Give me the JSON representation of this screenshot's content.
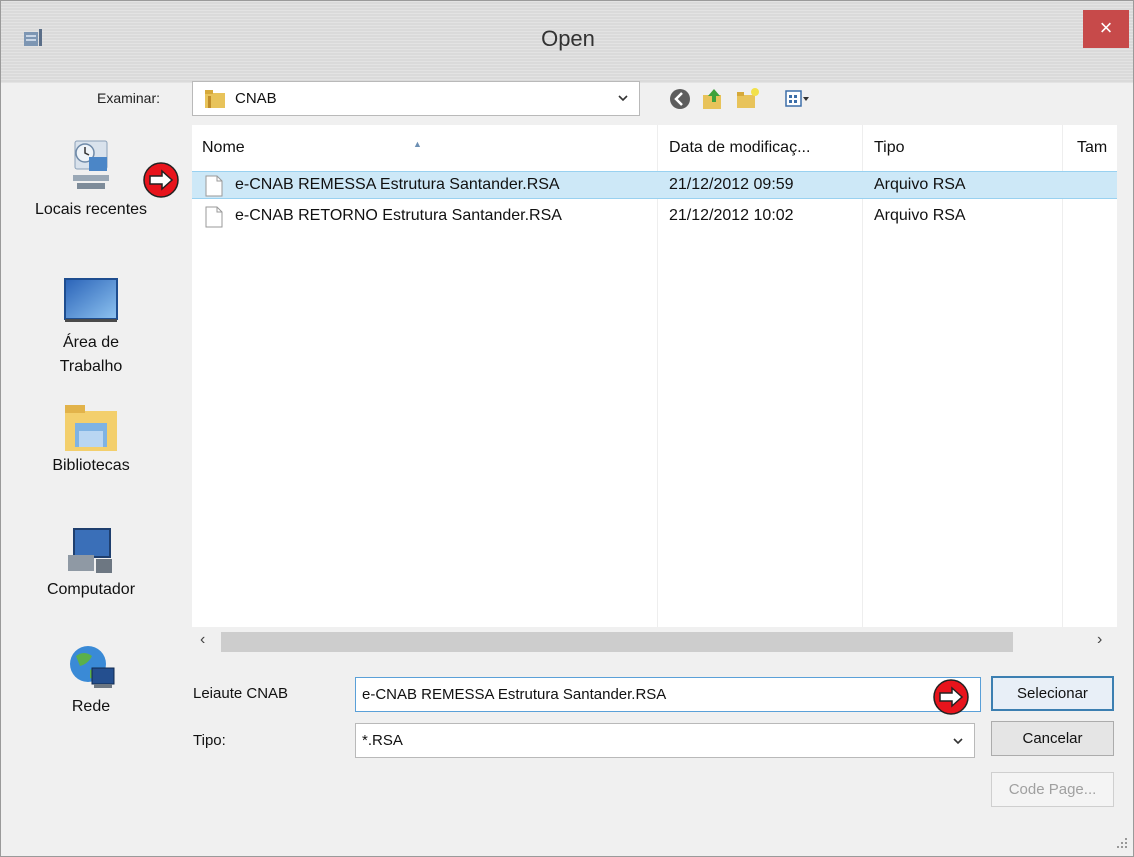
{
  "window": {
    "title": "Open",
    "close_label": "×"
  },
  "lookin": {
    "label": "Examinar:",
    "value": "CNAB"
  },
  "toolbar": {
    "icons": [
      "back-icon",
      "up-folder-icon",
      "new-folder-icon",
      "view-menu-icon"
    ]
  },
  "places": [
    {
      "label": "Locais recentes",
      "icon": "recent-places-icon"
    },
    {
      "label": "Área de Trabalho",
      "icon": "desktop-icon"
    },
    {
      "label": "Bibliotecas",
      "icon": "libraries-icon"
    },
    {
      "label": "Computador",
      "icon": "computer-icon"
    },
    {
      "label": "Rede",
      "icon": "network-icon"
    }
  ],
  "files": {
    "columns": [
      "Nome",
      "Data de modificaç...",
      "Tipo",
      "Tam"
    ],
    "rows": [
      {
        "name": "e-CNAB REMESSA Estrutura Santander.RSA",
        "date": "21/12/2012 09:59",
        "type": "Arquivo RSA",
        "selected": true
      },
      {
        "name": "e-CNAB RETORNO Estrutura Santander.RSA",
        "date": "21/12/2012 10:02",
        "type": "Arquivo RSA",
        "selected": false
      }
    ]
  },
  "scroll": {
    "left": "‹",
    "right": "›"
  },
  "form": {
    "filename_label": "Leiaute CNAB",
    "filename_value": "e-CNAB REMESSA Estrutura Santander.RSA",
    "type_label": "Tipo:",
    "type_value": "*.RSA"
  },
  "buttons": {
    "select": "Selecionar",
    "cancel": "Cancelar",
    "codepage": "Code Page..."
  },
  "colors": {
    "selection": "#cde8f7",
    "callout": "#e8141c",
    "close": "#c74a4a"
  }
}
